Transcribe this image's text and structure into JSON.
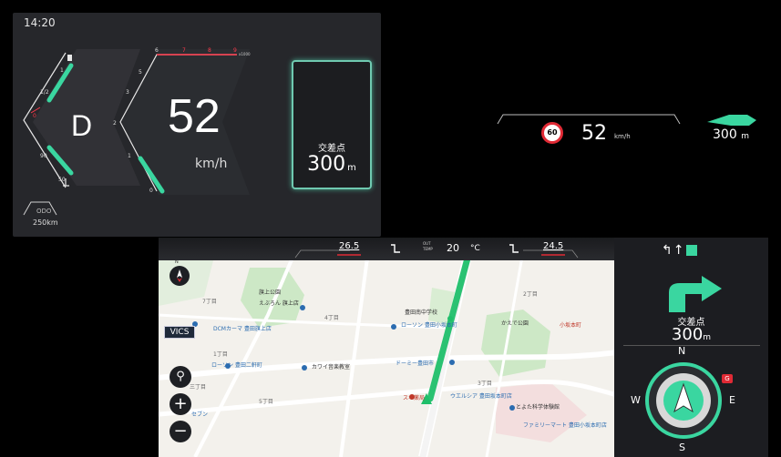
{
  "cluster": {
    "clock": "14:20",
    "gear": "D",
    "speed": "52",
    "speed_unit": "km/h",
    "fuel_marks": [
      "1",
      "1/2",
      "0"
    ],
    "temp_marks": [
      "90",
      "50"
    ],
    "tacho_marks": [
      "0",
      "1",
      "2",
      "3",
      "4",
      "5",
      "6"
    ],
    "tacho_red_marks": [
      "7",
      "8",
      "9"
    ],
    "tacho_multiplier": "x1000",
    "odo_label": "ODO",
    "odo_value": "250km",
    "turn_label": "交差点",
    "turn_distance": "300",
    "turn_unit": "m"
  },
  "hud": {
    "speed_limit": "60",
    "speed": "52",
    "speed_unit": "km/h",
    "distance": "300",
    "distance_unit": "m"
  },
  "climate": {
    "left_temp": "26.5",
    "right_temp": "24.5",
    "out_label_1": "OUT",
    "out_label_2": "TEMP",
    "out_temp": "20",
    "out_unit": "°C"
  },
  "map": {
    "compass_marker": "N",
    "vics_label": "VICS",
    "labels": {
      "kamishigo_park": "旗上公園",
      "supermarket": "えぶろん 旗上店",
      "ochiai": "落合",
      "school": "豊田南中学校",
      "lawson": "ローソン 豊田小坂本町",
      "kaede_park": "かえで公園",
      "lawson2": "ローソン 豊田二軒町",
      "kawai": "カワイ音楽教室",
      "dormy": "ドーミー豊田市",
      "sanchome": "三丁目",
      "seven": "セブン",
      "tamagawa": "玉川",
      "toyota": "トヨタ",
      "sakamoto": "小坂本町",
      "meiji": "明治",
      "ishiyama": "石山",
      "family": "ファミリーマート 豊田小坂本町店",
      "toyotsu": "とよた科学体験館",
      "welcia": "ウエルシア 豊田坂本町店",
      "pharmacy": "スギ薬局",
      "block_2": "2丁目",
      "block_3": "3丁目",
      "block_4": "4丁目",
      "block_5": "5丁目",
      "block_7": "7丁目",
      "block_1": "1丁目"
    },
    "dcm": "DCMカーマ 豊田旗上店"
  },
  "nav_side": {
    "lane_icons": "↰↑",
    "turn_label": "交差点",
    "distance": "300",
    "unit": "m",
    "compass": {
      "n": "N",
      "s": "S",
      "e": "E",
      "w": "W"
    },
    "g_badge": "G"
  },
  "colors": {
    "accent": "#3ad6a0",
    "route": "#1fbf6a",
    "red": "#e02a35"
  }
}
